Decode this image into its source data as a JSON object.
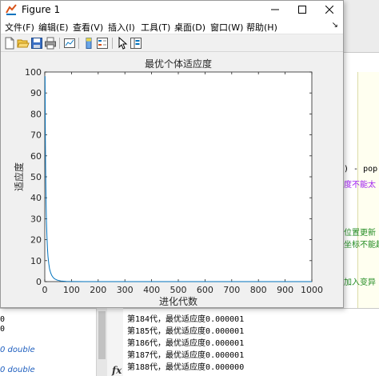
{
  "window": {
    "title": "Figure 1"
  },
  "menu": {
    "items": [
      "文件(F)",
      "编辑(E)",
      "查看(V)",
      "插入(I)",
      "工具(T)",
      "桌面(D)",
      "窗口(W)",
      "帮助(H)"
    ],
    "overflow": "↘"
  },
  "toolbar": {
    "icons": [
      "new-figure-icon",
      "open-file-icon",
      "save-icon",
      "print-icon",
      "link-plot-icon",
      "insert-colorbar-icon",
      "insert-legend-icon",
      "select-arrow-icon",
      "property-editor-icon"
    ]
  },
  "colors": {
    "line": "#0072bd",
    "axes_bg": "#ffffff",
    "figure_bg": "#f0f0f0"
  },
  "chart_data": {
    "type": "line",
    "title": "最优个体适应度",
    "xlabel": "进化代数",
    "ylabel": "适应度",
    "xlim": [
      0,
      1000
    ],
    "ylim": [
      0,
      100
    ],
    "xticks": [
      0,
      100,
      200,
      300,
      400,
      500,
      600,
      700,
      800,
      900,
      1000
    ],
    "yticks": [
      0,
      10,
      20,
      30,
      40,
      50,
      60,
      70,
      80,
      90,
      100
    ],
    "grid": false,
    "series": [
      {
        "x": [
          1,
          2,
          3,
          4,
          5,
          6,
          8,
          10,
          12,
          15,
          18,
          22,
          26,
          30,
          35,
          40,
          45,
          50,
          60,
          80,
          100,
          150,
          200,
          300,
          500,
          700,
          1000
        ],
        "values": [
          98,
          72,
          57,
          46,
          37,
          30,
          22,
          16,
          12,
          8.5,
          6,
          4.2,
          3,
          2.2,
          1.5,
          1.1,
          0.8,
          0.6,
          0.3,
          0.1,
          0.05,
          0.01,
          0,
          0,
          0,
          0,
          0
        ]
      }
    ]
  },
  "editor": {
    "lines": [
      {
        "text": ") - pop",
        "style": "black"
      },
      {
        "text": "度不能太",
        "style": "purple"
      },
      {
        "text": "位置更新",
        "style": "green"
      },
      {
        "text": "坐标不能超",
        "style": "green"
      },
      {
        "text": "加入变异",
        "style": "green"
      }
    ]
  },
  "workspace": {
    "lines": [
      {
        "text": "0",
        "style": "plain"
      },
      {
        "text": "0",
        "style": "plain"
      },
      {
        "text": "0 double",
        "style": "blue"
      },
      {
        "text": "0 double",
        "style": "blue"
      }
    ]
  },
  "console": {
    "lines": [
      "第184代，最优适应度0.000001",
      "第185代，最优适应度0.000001",
      "第186代，最优适应度0.000001",
      "第187代，最优适应度0.000001",
      "第188代，最优适应度0.000000"
    ],
    "prompt_icon": "fx"
  }
}
